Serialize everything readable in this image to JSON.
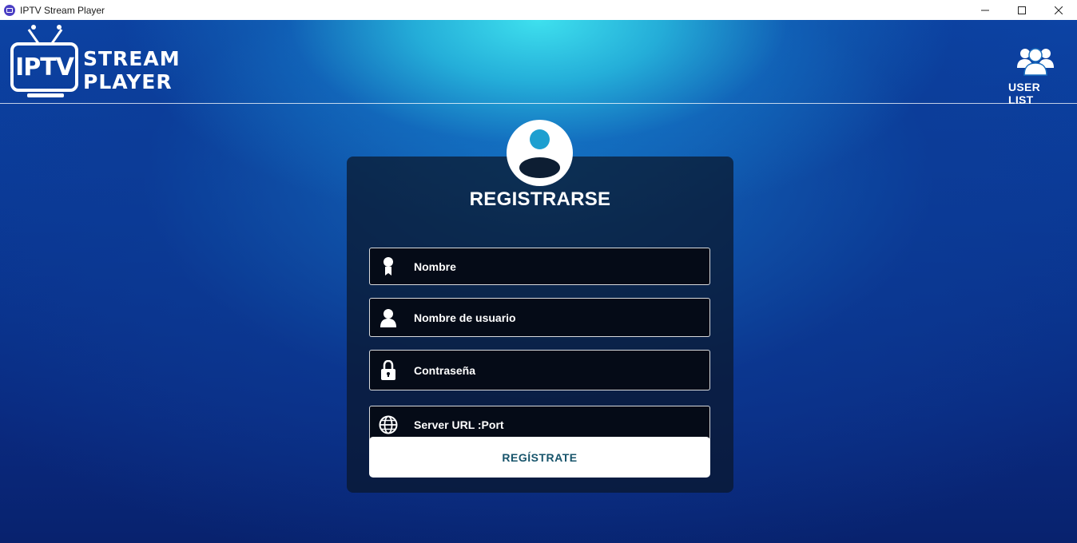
{
  "window": {
    "title": "IPTV Stream Player",
    "controls": {
      "minimize": "—",
      "maximize": "☐",
      "close": "✕"
    }
  },
  "logo": {
    "tv_text": "IPTV",
    "line1": "STREAM",
    "line2": "PLAYER"
  },
  "header": {
    "user_list_label": "USER LIST"
  },
  "register": {
    "title": "REGISTRARSE",
    "fields": [
      {
        "placeholder": "Nombre",
        "icon": "badge-icon"
      },
      {
        "placeholder": "Nombre de usuario",
        "icon": "user-icon"
      },
      {
        "placeholder": "Contraseña",
        "icon": "lock-icon"
      },
      {
        "placeholder": "Server URL :Port",
        "icon": "globe-icon"
      }
    ],
    "submit_label": "REGÍSTRATE"
  }
}
